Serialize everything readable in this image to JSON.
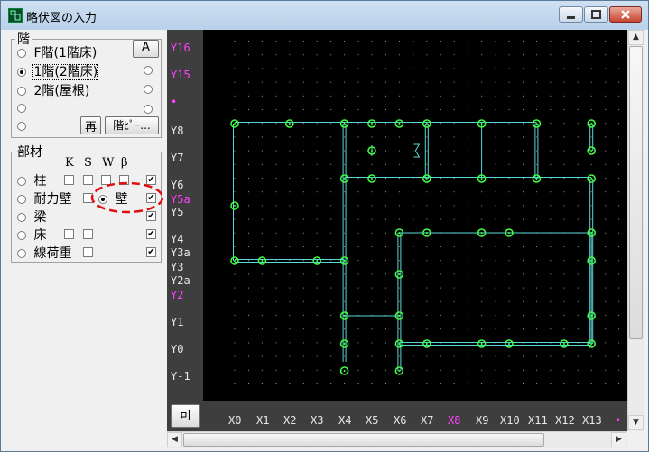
{
  "window": {
    "title": "略伏図の入力"
  },
  "floor": {
    "legend": "階",
    "letter_btn": "A",
    "options": [
      {
        "label": "F階(1階床)",
        "checked": false
      },
      {
        "label": "1階(2階床)",
        "checked": true
      },
      {
        "label": "2階(屋根)",
        "checked": false
      },
      {
        "label": "",
        "checked": false
      },
      {
        "label": "",
        "checked": false
      }
    ],
    "redraw_btn": "再",
    "floor_height_btn": "階ﾋﾟｰ..."
  },
  "members": {
    "legend": "部材",
    "col_headers": [
      "K",
      "S",
      "W",
      "β"
    ],
    "rows": [
      {
        "label": "柱",
        "k": false,
        "s": false,
        "w": false,
        "beta": true
      },
      {
        "label": "耐力壁",
        "k": false,
        "beta": true
      },
      {
        "label": "梁",
        "beta": true
      },
      {
        "label": "床",
        "k": false,
        "s": false,
        "beta": true
      },
      {
        "label": "線荷重",
        "k": false,
        "beta": true
      }
    ],
    "wall_radio": {
      "label": "壁",
      "checked": true
    }
  },
  "plan": {
    "ka_button": "可",
    "y_labels": [
      {
        "text": "Y16",
        "color": "#ff40ff"
      },
      {
        "text": "Y15",
        "color": "#ff40ff"
      },
      {
        "text": "•",
        "color": "#ff40ff"
      },
      {
        "text": "Y8",
        "color": "#e8e8e8"
      },
      {
        "text": "Y7",
        "color": "#e8e8e8"
      },
      {
        "text": "Y6",
        "color": "#e8e8e8"
      },
      {
        "text": "Y5a",
        "color": "#ff40ff"
      },
      {
        "text": "Y5",
        "color": "#e8e8e8"
      },
      {
        "text": "Y4",
        "color": "#e8e8e8"
      },
      {
        "text": "Y3a",
        "color": "#e8e8e8"
      },
      {
        "text": "Y3",
        "color": "#e8e8e8"
      },
      {
        "text": "Y2a",
        "color": "#e8e8e8"
      },
      {
        "text": "Y2",
        "color": "#ff40ff"
      },
      {
        "text": "Y1",
        "color": "#e8e8e8"
      },
      {
        "text": "Y0",
        "color": "#e8e8e8"
      },
      {
        "text": "Y-1",
        "color": "#e8e8e8"
      }
    ],
    "x_labels": [
      {
        "text": "X0",
        "color": "#e8e8e8"
      },
      {
        "text": "X1",
        "color": "#e8e8e8"
      },
      {
        "text": "X2",
        "color": "#e8e8e8"
      },
      {
        "text": "X3",
        "color": "#e8e8e8"
      },
      {
        "text": "X4",
        "color": "#e8e8e8"
      },
      {
        "text": "X5",
        "color": "#e8e8e8"
      },
      {
        "text": "X6",
        "color": "#e8e8e8"
      },
      {
        "text": "X7",
        "color": "#e8e8e8"
      },
      {
        "text": "X8",
        "color": "#ff40ff"
      },
      {
        "text": "X9",
        "color": "#e8e8e8"
      },
      {
        "text": "X10",
        "color": "#e8e8e8"
      },
      {
        "text": "X11",
        "color": "#e8e8e8"
      },
      {
        "text": "X12",
        "color": "#e8e8e8"
      },
      {
        "text": "X13",
        "color": "#e8e8e8"
      },
      {
        "text": "•",
        "color": "#ff40ff"
      }
    ],
    "colors": {
      "wall": "#5ad8d8",
      "node": "#40ff40",
      "grid_dot": "#9a9a9a",
      "background": "#000000",
      "highlight": "#e01010"
    }
  }
}
